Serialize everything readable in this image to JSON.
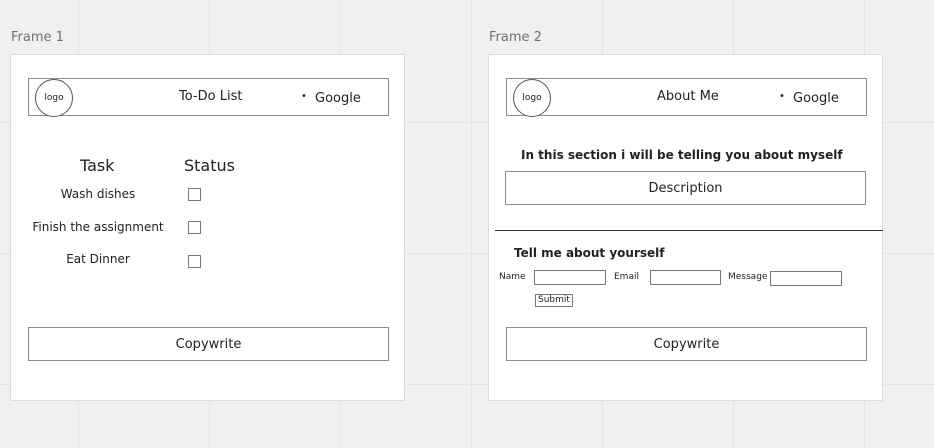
{
  "frame1": {
    "title": "Frame 1",
    "header": {
      "logo": "logo",
      "title": "To-Do List",
      "bullet": "•",
      "link": "Google"
    },
    "table": {
      "headers": {
        "task": "Task",
        "status": "Status"
      },
      "rows": [
        {
          "task": "Wash dishes",
          "checked": false
        },
        {
          "task": "Finish the assignment",
          "checked": false
        },
        {
          "task": "Eat Dinner",
          "checked": false
        }
      ]
    },
    "footer": "Copywrite"
  },
  "frame2": {
    "title": "Frame 2",
    "header": {
      "logo": "logo",
      "title": "About Me",
      "bullet": "•",
      "link": "Google"
    },
    "intro_heading": "In this section i will be telling you about myself",
    "description": "Description",
    "form": {
      "heading": "Tell me about yourself",
      "name_label": "Name",
      "email_label": "Email",
      "message_label": "Message",
      "name_value": "",
      "email_value": "",
      "message_value": "",
      "submit": "Submit"
    },
    "footer": "Copywrite"
  }
}
